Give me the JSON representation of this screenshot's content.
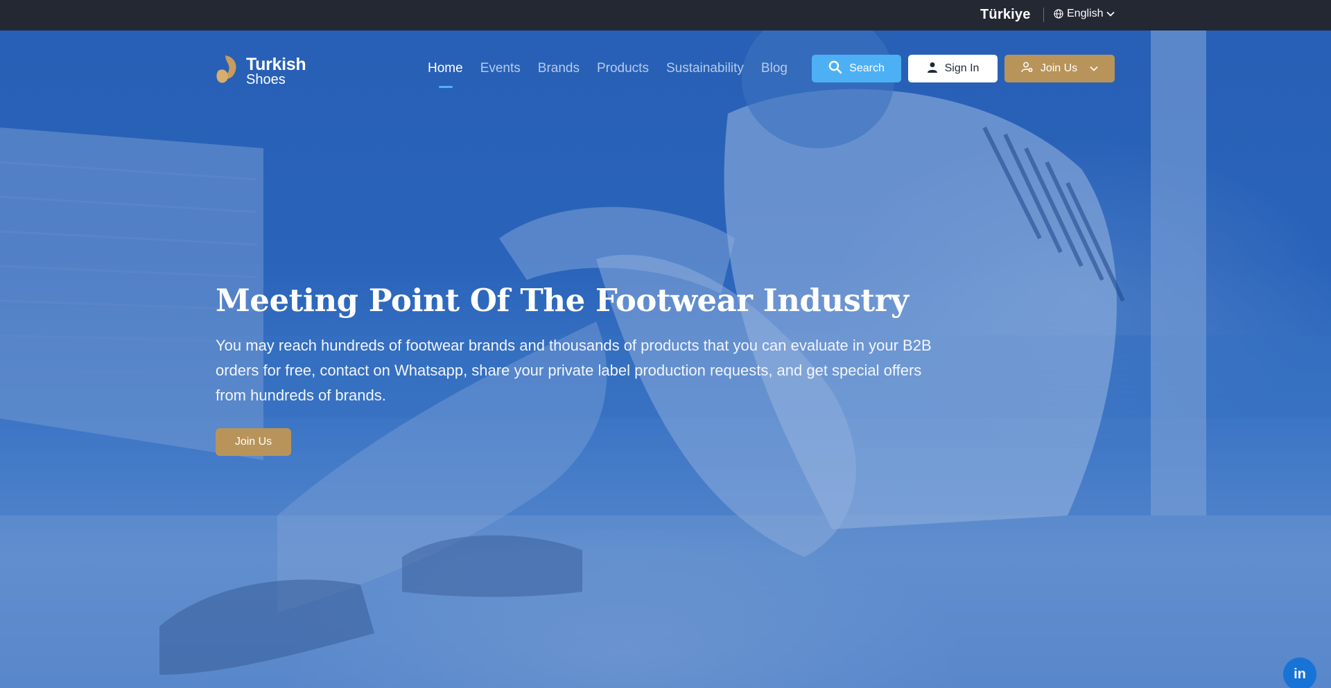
{
  "topbar": {
    "country": "Türkiye",
    "language": "English"
  },
  "logo": {
    "line1": "Turkish",
    "line2": "Shoes"
  },
  "nav": {
    "items": [
      {
        "label": "Home",
        "active": true
      },
      {
        "label": "Events",
        "active": false
      },
      {
        "label": "Brands",
        "active": false
      },
      {
        "label": "Products",
        "active": false
      },
      {
        "label": "Sustainability",
        "active": false
      },
      {
        "label": "Blog",
        "active": false
      }
    ]
  },
  "buttons": {
    "search": "Search",
    "signin": "Sign In",
    "join": "Join Us"
  },
  "hero": {
    "headline": "Meeting Point Of The Footwear Industry",
    "description": "You may reach hundreds of footwear brands and thousands of products that you can evaluate in your B2B orders for free, contact on Whatsapp, share your private label production requests, and get special offers from hundreds of brands.",
    "cta": "Join Us"
  },
  "social": {
    "linkedin": "in"
  },
  "colors": {
    "topbar": "#232833",
    "accent_gold": "#b8945a",
    "search_blue": "#4db0f4",
    "nav_active_underline": "#4fb3f5",
    "linkedin": "#1873d6"
  },
  "icons": [
    "globe-icon",
    "chevron-down-icon",
    "search-icon",
    "user-icon",
    "user-plus-icon",
    "linkedin-icon"
  ]
}
